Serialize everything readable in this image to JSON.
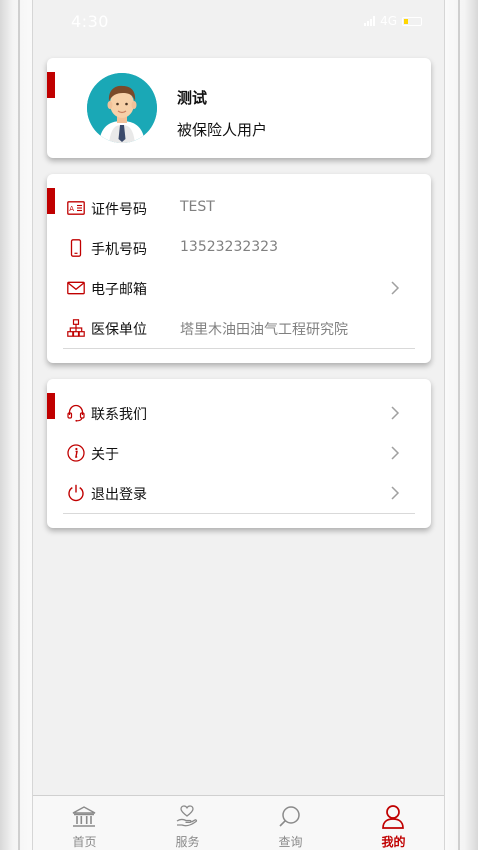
{
  "status_bar": {
    "time": "4:30",
    "network": "4G"
  },
  "profile": {
    "name": "测试",
    "user_type": "被保险人用户"
  },
  "info_rows": [
    {
      "label": "证件号码",
      "value": "TEST",
      "icon": "id-card-icon"
    },
    {
      "label": "手机号码",
      "value": "13523232323",
      "icon": "phone-icon"
    },
    {
      "label": "电子邮箱",
      "value": "",
      "icon": "mail-icon"
    },
    {
      "label": "医保单位",
      "value": "塔里木油田油气工程研究院",
      "icon": "org-chart-icon"
    }
  ],
  "link_rows": [
    {
      "label": "联系我们",
      "icon": "headset-icon"
    },
    {
      "label": "关于",
      "icon": "info-icon"
    },
    {
      "label": "退出登录",
      "icon": "power-icon"
    }
  ],
  "tabs": [
    {
      "label": "首页",
      "icon": "bank-icon"
    },
    {
      "label": "服务",
      "icon": "care-hand-icon"
    },
    {
      "label": "查询",
      "icon": "search-icon"
    },
    {
      "label": "我的",
      "icon": "user-icon"
    }
  ],
  "colors": {
    "accent": "#c00000",
    "background": "#f1f1f1",
    "muted_text": "#808080"
  }
}
